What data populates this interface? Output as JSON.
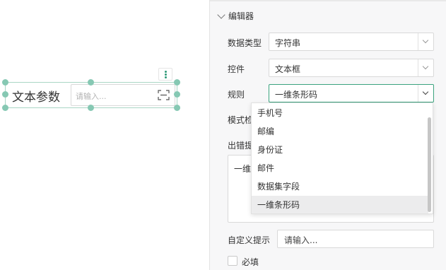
{
  "canvas": {
    "widget_label": "文本参数",
    "widget_placeholder": "请输入..."
  },
  "panel": {
    "section_title": "编辑器",
    "data_type_label": "数据类型",
    "data_type_value": "字符串",
    "control_label": "控件",
    "control_value": "文本框",
    "rule_label": "规则",
    "rule_value": "一维条形码",
    "pattern_label_partial": "模式检",
    "error_label_partial": "出错提",
    "error_text_partial": "一维",
    "custom_hint_label": "自定义提示",
    "custom_hint_placeholder": "请输入...",
    "required_label": "必填"
  },
  "dropdown": {
    "items": [
      "手机号",
      "邮编",
      "身份证",
      "邮件",
      "数据集字段",
      "一维条形码"
    ],
    "selected_index": 5
  },
  "colors": {
    "accent": "#3ba37e",
    "handle": "#86c8b3"
  }
}
